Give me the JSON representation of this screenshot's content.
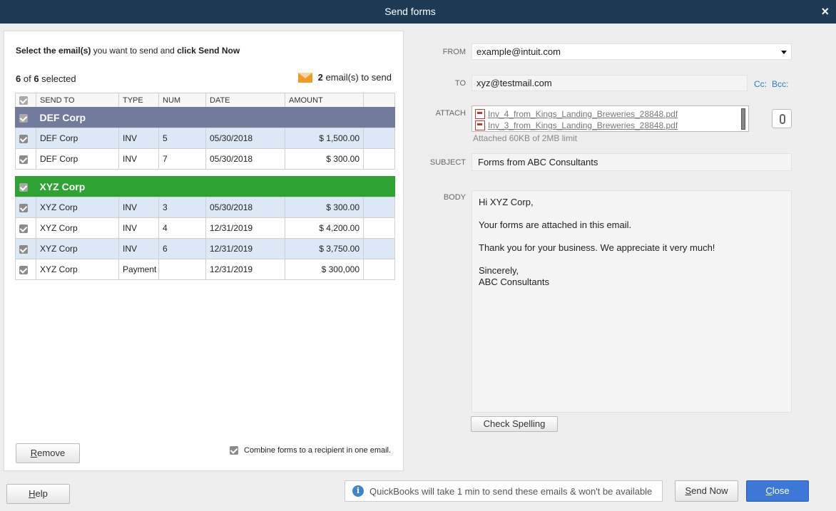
{
  "window": {
    "title": "Send forms",
    "close_glyph": "×"
  },
  "left": {
    "instruction_bold1": "Select the email(s)",
    "instruction_mid": " you want to send and ",
    "instruction_bold2": "click Send Now",
    "selected_count": "6",
    "selected_of": " of ",
    "selected_total": "6",
    "selected_suffix": " selected",
    "emails_count": "2",
    "emails_suffix": " email(s) to send",
    "columns": [
      "SEND TO",
      "TYPE",
      "NUM",
      "DATE",
      "AMOUNT"
    ],
    "groups": [
      {
        "name": "DEF Corp",
        "color": "#717c9c",
        "rows": [
          {
            "send_to": "DEF Corp",
            "type": "INV",
            "num": "5",
            "date": "05/30/2018",
            "amount": "$ 1,500.00"
          },
          {
            "send_to": "DEF Corp",
            "type": "INV",
            "num": "7",
            "date": "05/30/2018",
            "amount": "$ 300.00"
          }
        ]
      },
      {
        "name": "XYZ Corp",
        "color": "#2ea232",
        "rows": [
          {
            "send_to": "XYZ Corp",
            "type": "INV",
            "num": "3",
            "date": "05/30/2018",
            "amount": "$ 300.00"
          },
          {
            "send_to": "XYZ Corp",
            "type": "INV",
            "num": "4",
            "date": "12/31/2019",
            "amount": "$ 4,200.00"
          },
          {
            "send_to": "XYZ Corp",
            "type": "INV",
            "num": "6",
            "date": "12/31/2019",
            "amount": "$ 3,750.00"
          },
          {
            "send_to": "XYZ Corp",
            "type": "Payment",
            "num": "",
            "date": "12/31/2019",
            "amount": "$ 300,000"
          }
        ]
      }
    ],
    "remove_rest": "emove",
    "remove_key": "R",
    "combine_label": "Combine forms to a recipient in one email."
  },
  "form": {
    "from_label": "FROM",
    "from_value": "example@intuit.com",
    "to_label": "TO",
    "to_value": "xyz@testmail.com",
    "cc": "Cc:",
    "bcc": "Bcc:",
    "attach_label": "ATTACH",
    "attachments": [
      "Inv_4_from_Kings_Landing_Breweries_28848.pdf",
      "Inv_3_from_Kings_Landing_Breweries_28848.pdf"
    ],
    "attach_info": "Attached 60KB of 2MB limit",
    "subject_label": "SUBJECT",
    "subject_value": "Forms from ABC Consultants",
    "body_label": "BODY",
    "body_lines": [
      "Hi XYZ Corp,",
      "Your forms are attached in this email.",
      "Thank you for your business. We appreciate it very much!",
      "Sincerely,",
      "ABC Consultants"
    ],
    "check_spelling": "Check Spelling"
  },
  "footer": {
    "help_key": "H",
    "help_rest": "elp",
    "notice": "QuickBooks will take 1 min to send these emails & won't be available",
    "send_now_key": "S",
    "send_now_rest": "end Now",
    "close_key": "C",
    "close_rest": "lose"
  }
}
